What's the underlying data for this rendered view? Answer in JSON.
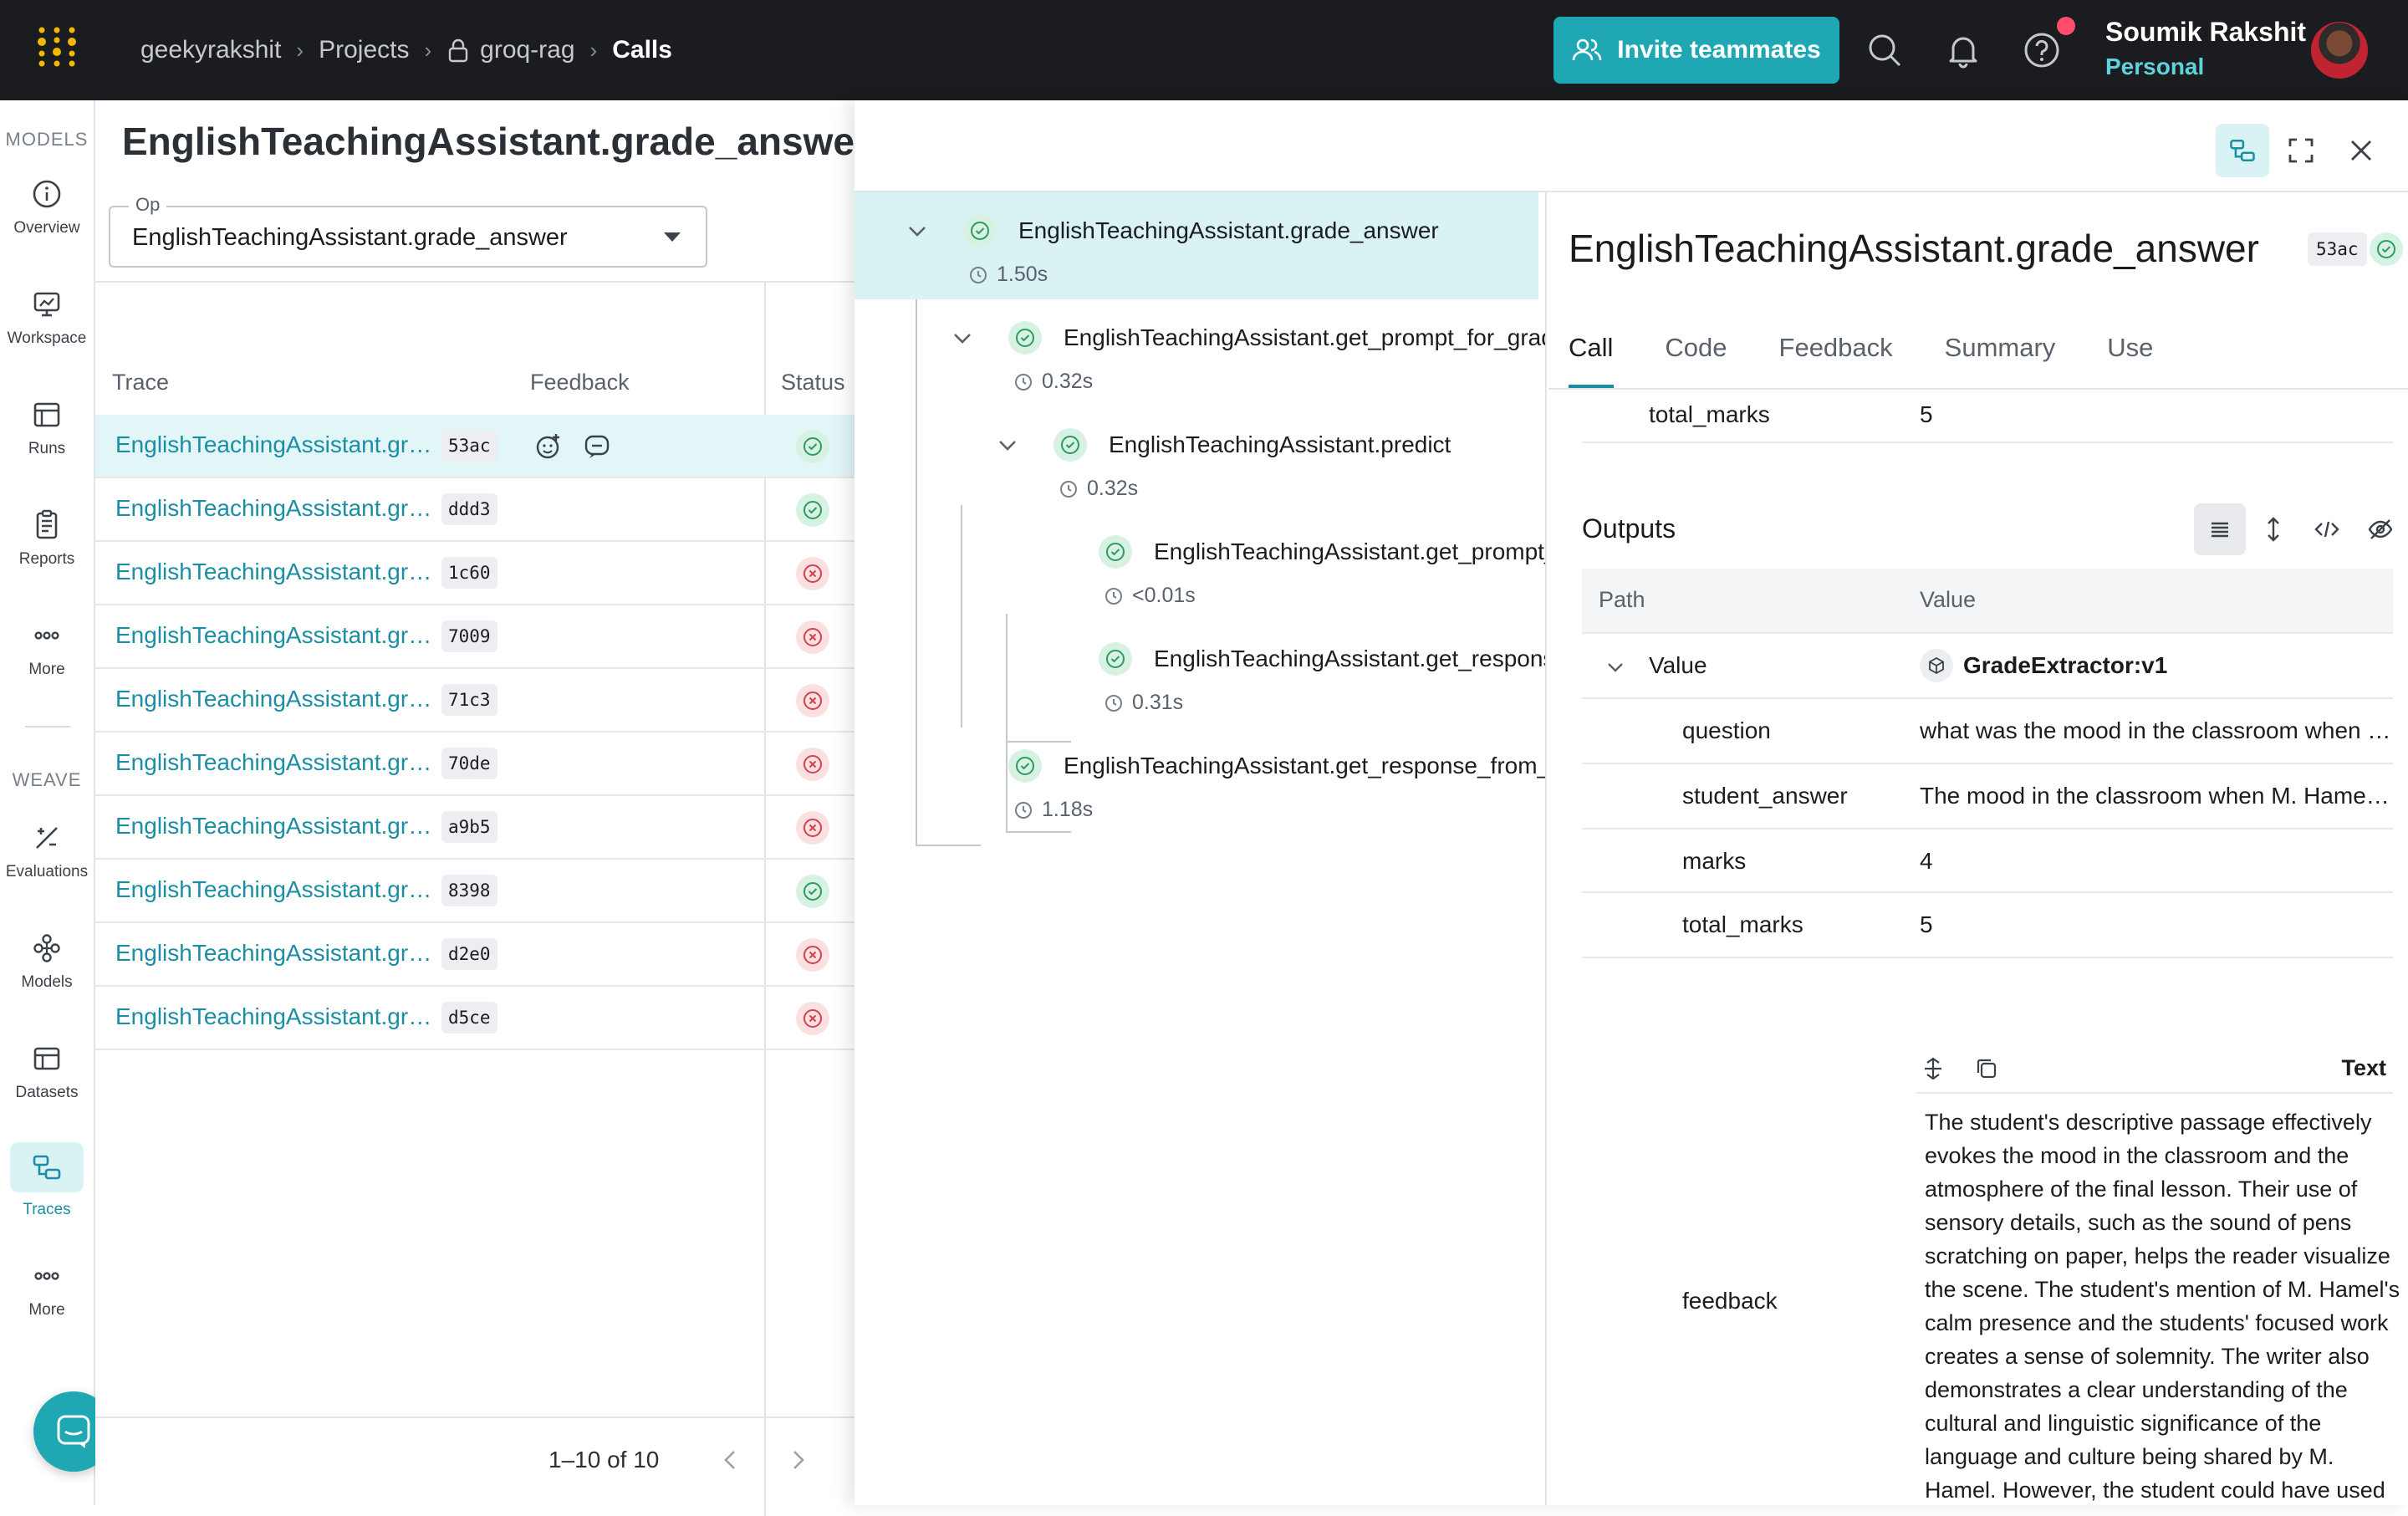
{
  "topbar": {
    "breadcrumb": [
      "geekyrakshit",
      "Projects",
      "groq-rag",
      "Calls"
    ],
    "invite_label": "Invite teammates",
    "user_name": "Soumik Rakshit",
    "user_plan": "Personal"
  },
  "leftnav": {
    "models_heading": "MODELS",
    "weave_heading": "WEAVE",
    "models_items": [
      {
        "label": "Overview",
        "icon": "info-icon"
      },
      {
        "label": "Workspace",
        "icon": "workspace-icon"
      },
      {
        "label": "Runs",
        "icon": "runs-icon"
      },
      {
        "label": "Reports",
        "icon": "reports-icon"
      },
      {
        "label": "More",
        "icon": "more-icon"
      }
    ],
    "weave_items": [
      {
        "label": "Evaluations",
        "icon": "evaluations-icon"
      },
      {
        "label": "Models",
        "icon": "models-icon"
      },
      {
        "label": "Datasets",
        "icon": "datasets-icon"
      },
      {
        "label": "Traces",
        "icon": "traces-icon",
        "active": true
      },
      {
        "label": "More",
        "icon": "more-icon"
      }
    ]
  },
  "main": {
    "title": "EnglishTeachingAssistant.grade_answer Tr",
    "op_label": "Op",
    "op_value": "EnglishTeachingAssistant.grade_answer",
    "columns": {
      "trace": "Trace",
      "feedback": "Feedback",
      "status": "Status"
    },
    "rows": [
      {
        "name": "EnglishTeachingAssistant.grade_answer",
        "id": "53ac",
        "status": "success",
        "selected": true
      },
      {
        "name": "EnglishTeachingAssistant.grade_answer",
        "id": "ddd3",
        "status": "success"
      },
      {
        "name": "EnglishTeachingAssistant.grade_answer",
        "id": "1c60",
        "status": "error"
      },
      {
        "name": "EnglishTeachingAssistant.grade_answer",
        "id": "7009",
        "status": "error"
      },
      {
        "name": "EnglishTeachingAssistant.grade_answer",
        "id": "71c3",
        "status": "error"
      },
      {
        "name": "EnglishTeachingAssistant.grade_answer",
        "id": "70de",
        "status": "error"
      },
      {
        "name": "EnglishTeachingAssistant.grade_answer",
        "id": "a9b5",
        "status": "error"
      },
      {
        "name": "EnglishTeachingAssistant.grade_answer",
        "id": "8398",
        "status": "success"
      },
      {
        "name": "EnglishTeachingAssistant.grade_answer",
        "id": "d2e0",
        "status": "error"
      },
      {
        "name": "EnglishTeachingAssistant.grade_answer",
        "id": "d5ce",
        "status": "error"
      }
    ],
    "pager": "1–10 of 10"
  },
  "tree": [
    {
      "name": "EnglishTeachingAssistant.grade_answer",
      "duration": "1.50s"
    },
    {
      "name": "EnglishTeachingAssistant.get_prompt_for_grad",
      "duration": "0.32s"
    },
    {
      "name": "EnglishTeachingAssistant.predict",
      "duration": "0.32s"
    },
    {
      "name": "EnglishTeachingAssistant.get_prompt_",
      "duration": "<0.01s"
    },
    {
      "name": "EnglishTeachingAssistant.get_response",
      "duration": "0.31s"
    },
    {
      "name": "EnglishTeachingAssistant.get_response_from_g",
      "duration": "1.18s"
    }
  ],
  "details": {
    "title": "EnglishTeachingAssistant.grade_answer",
    "id": "53ac",
    "tabs": [
      "Call",
      "Code",
      "Feedback",
      "Summary",
      "Use"
    ],
    "input_row": {
      "key": "total_marks",
      "value": "5"
    },
    "outputs_title": "Outputs",
    "out_cols": {
      "path": "Path",
      "value": "Value"
    },
    "value_key": "Value",
    "value_ref": "GradeExtractor:v1",
    "rows": [
      {
        "key": "question",
        "value": "what was the mood in the classroom when M. Hamel gave his last lesson?"
      },
      {
        "key": "student_answer",
        "value": "The mood in the classroom when M. Hamel gave his last lesson was solemn."
      },
      {
        "key": "marks",
        "value": "4"
      },
      {
        "key": "total_marks",
        "value": "5"
      }
    ],
    "feedback_key": "feedback",
    "feedback_mode": "Text",
    "feedback_text": "The student's descriptive passage effectively evokes the mood in the classroom and the atmosphere of the final lesson. Their use of sensory details, such as the sound of pens scratching on paper, helps the reader visualize the scene. The student's mention of M. Hamel's calm presence and the students' focused work creates a sense of solemnity. The writer also demonstrates a clear understanding of the cultural and linguistic significance of the language and culture being shared by M. Hamel. However, the student could have used more varied sentence structures to improve clarity and flow."
  }
}
